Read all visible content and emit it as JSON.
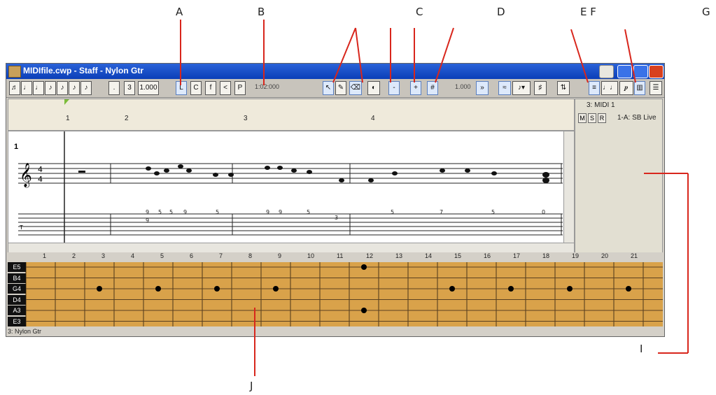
{
  "callouts": {
    "A": "A",
    "B": "B",
    "C": "C",
    "D": "D",
    "EF": "E F",
    "G": "G",
    "I": "I",
    "J": "J"
  },
  "window": {
    "title": "MIDIfile.cwp - Staff - Nylon Gtr",
    "title_icon": "app-icon",
    "buttons": [
      "lock-icon",
      "minimize-icon",
      "maximize-icon",
      "close-icon"
    ]
  },
  "toolbar": {
    "durations": [
      "1/16",
      "1/4",
      "1/4",
      "1/8",
      "1/8",
      "1/8",
      "1/8"
    ],
    "dot_label": ".",
    "triplet_label": "3",
    "tempo_value": "1.000",
    "tool_L": "L",
    "tool_C": "C",
    "tool_f": "f",
    "tool_lt": "<",
    "tool_pedal": "P",
    "position_readout": "1:02:000",
    "zoom_value": "1.000",
    "colors": {
      "title_bar": "#1a4fc8",
      "accent_red": "#d8401e",
      "fretboard": "#d9a24a",
      "fret_dot": "#000000"
    }
  },
  "ruler": {
    "bars": [
      "1",
      "2",
      "3",
      "4"
    ]
  },
  "staff": {
    "measure_number": "1"
  },
  "track": {
    "name": "3: MIDI 1",
    "buttons": [
      "M",
      "S",
      "R"
    ],
    "port": "1-A: SB Live"
  },
  "fretboard": {
    "fret_numbers": [
      "1",
      "2",
      "3",
      "4",
      "5",
      "6",
      "7",
      "8",
      "9",
      "10",
      "11",
      "12",
      "13",
      "14",
      "15",
      "16",
      "17",
      "18",
      "19",
      "20",
      "21"
    ],
    "strings": [
      "E5",
      "B4",
      "G4",
      "D4",
      "A3",
      "E3"
    ]
  },
  "status_text": "3: Nylon Gtr"
}
